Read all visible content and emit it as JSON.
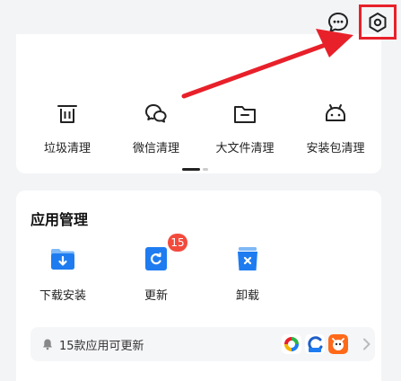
{
  "header": {
    "message_icon": "chat-bubble-icon",
    "settings_icon": "hexagon-settings-icon"
  },
  "tools": [
    {
      "label": "垃圾清理",
      "icon": "trash-icon"
    },
    {
      "label": "微信清理",
      "icon": "wechat-icon"
    },
    {
      "label": "大文件清理",
      "icon": "folder-icon"
    },
    {
      "label": "安装包清理",
      "icon": "android-icon"
    }
  ],
  "app_manage": {
    "title": "应用管理",
    "items": [
      {
        "label": "下载安装",
        "icon": "download-folder-icon"
      },
      {
        "label": "更新",
        "icon": "update-icon",
        "badge": "15"
      },
      {
        "label": "卸载",
        "icon": "uninstall-icon"
      }
    ],
    "update_hint": "15款应用可更新"
  },
  "colors": {
    "accent_blue": "#1e7cf0",
    "highlight_red": "#e8202a",
    "badge_red": "#f24a3c"
  }
}
